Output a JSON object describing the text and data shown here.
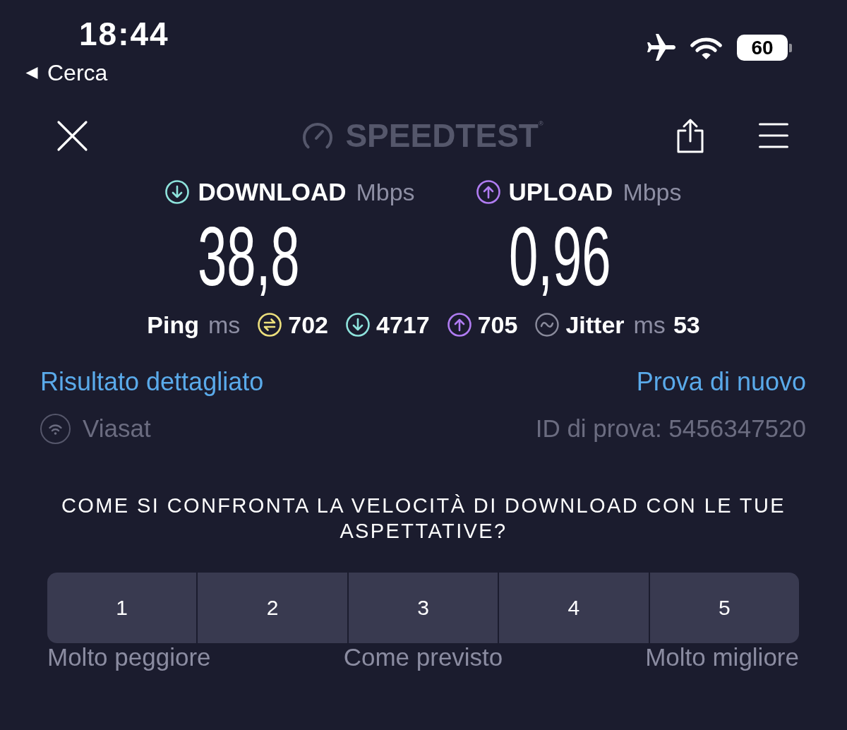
{
  "status_bar": {
    "time": "18:44",
    "back_label": "Cerca",
    "battery": "60"
  },
  "header": {
    "logo": "SPEEDTEST$^{®}$"
  },
  "speeds": [
    {
      "kind": "download",
      "label": "DOWNLOAD",
      "unit": "Mbps",
      "value": "38,8",
      "color": "#8ee3dc"
    },
    {
      "kind": "upload",
      "label": "UPLOAD",
      "unit": "Mbps",
      "value": "0,96",
      "color": "#b07cf2"
    }
  ],
  "latency": {
    "label": "Ping",
    "unit": "ms",
    "items": [
      {
        "kind": "idle",
        "value": "702",
        "color": "#ecdf7c"
      },
      {
        "kind": "download",
        "value": "4717",
        "color": "#8ee3dc"
      },
      {
        "kind": "upload",
        "value": "705",
        "color": "#b07cf2"
      }
    ]
  },
  "jitter": {
    "label": "Jitter",
    "unit": "ms",
    "value": "53"
  },
  "links": {
    "detailed_result": "Risultato dettagliato",
    "retry": "Prova di nuovo"
  },
  "provider": {
    "name": "Viasat",
    "test_id": "ID di prova: 5456347520"
  },
  "survey": {
    "question": "COME SI CONFRONTA LA VELOCITÀ DI DOWNLOAD CON LE TUE ASPETTATIVE?",
    "options": [
      {
        "label": "1",
        "selected": false
      },
      {
        "label": "2",
        "selected": false
      },
      {
        "label": "3",
        "selected": false
      },
      {
        "label": "4",
        "selected": false
      },
      {
        "label": "5",
        "selected": false
      }
    ],
    "scale_labels": [
      "Molto peggiore",
      "Come previsto",
      "Molto migliore"
    ]
  }
}
